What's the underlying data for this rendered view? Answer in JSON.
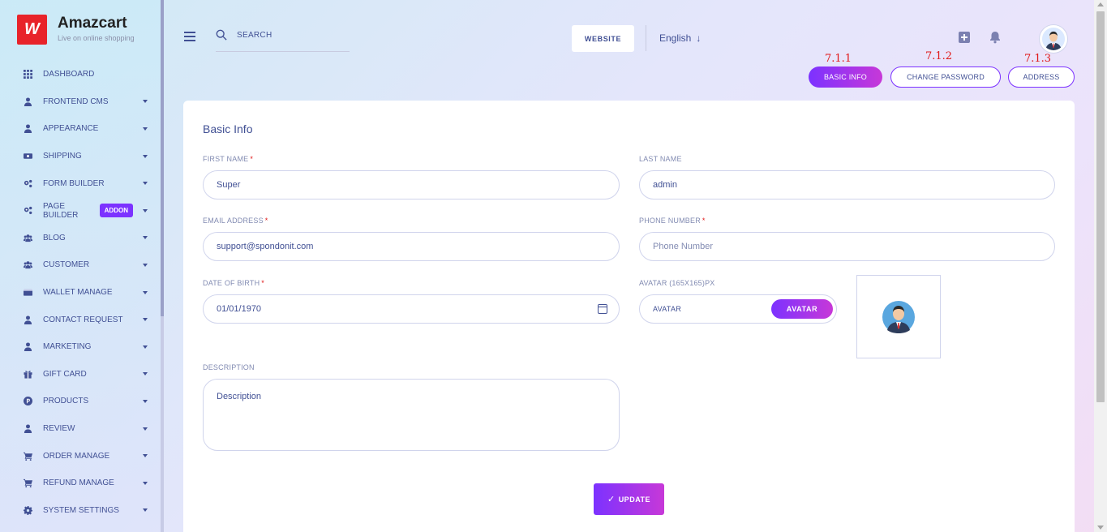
{
  "brand": {
    "title": "Amazcart",
    "subtitle": "Live on online shopping",
    "logo_glyph": "W",
    "color": "#e8232a"
  },
  "sidebar": {
    "items": [
      {
        "label": "DASHBOARD",
        "icon": "grid-icon",
        "has_caret": false
      },
      {
        "label": "FRONTEND CMS",
        "icon": "user-icon",
        "has_caret": true
      },
      {
        "label": "APPEARANCE",
        "icon": "user-icon",
        "has_caret": true
      },
      {
        "label": "SHIPPING",
        "icon": "truck-icon",
        "has_caret": true
      },
      {
        "label": "FORM BUILDER",
        "icon": "gears-icon",
        "has_caret": true
      },
      {
        "label": "PAGE BUILDER",
        "icon": "gears-icon",
        "has_caret": true,
        "badge": "ADDON"
      },
      {
        "label": "BLOG",
        "icon": "users-icon",
        "has_caret": true
      },
      {
        "label": "CUSTOMER",
        "icon": "users-icon",
        "has_caret": true
      },
      {
        "label": "WALLET MANAGE",
        "icon": "wallet-icon",
        "has_caret": true
      },
      {
        "label": "CONTACT REQUEST",
        "icon": "user-icon",
        "has_caret": true
      },
      {
        "label": "MARKETING",
        "icon": "user-icon",
        "has_caret": true
      },
      {
        "label": "GIFT CARD",
        "icon": "gift-icon",
        "has_caret": true
      },
      {
        "label": "PRODUCTS",
        "icon": "product-hunt-icon",
        "has_caret": true
      },
      {
        "label": "REVIEW",
        "icon": "user-icon",
        "has_caret": true
      },
      {
        "label": "ORDER MANAGE",
        "icon": "cart-icon",
        "has_caret": true
      },
      {
        "label": "REFUND MANAGE",
        "icon": "cart-icon",
        "has_caret": true
      },
      {
        "label": "SYSTEM SETTINGS",
        "icon": "gear-icon",
        "has_caret": true
      }
    ]
  },
  "header": {
    "search_placeholder": "SEARCH",
    "website_label": "WEBSITE",
    "language": "English",
    "language_arrow": "↓"
  },
  "tabs": [
    {
      "number": "7.1.1",
      "label": "BASIC INFO",
      "active": true
    },
    {
      "number": "7.1.2",
      "label": "CHANGE PASSWORD",
      "active": false
    },
    {
      "number": "7.1.3",
      "label": "ADDRESS",
      "active": false
    }
  ],
  "form": {
    "title": "Basic Info",
    "required_mark": "*",
    "first_name": {
      "label": "FIRST NAME",
      "value": "Super"
    },
    "last_name": {
      "label": "LAST NAME",
      "value": "admin"
    },
    "email": {
      "label": "EMAIL ADDRESS",
      "value": "support@spondonit.com"
    },
    "phone": {
      "label": "PHONE NUMBER",
      "placeholder": "Phone Number"
    },
    "dob": {
      "label": "DATE OF BIRTH",
      "value": "01/01/1970"
    },
    "avatar": {
      "label": "AVATAR (165X165)PX",
      "placeholder": "AVATAR",
      "button": "AVATAR"
    },
    "description": {
      "label": "DESCRIPTION",
      "placeholder": "Description"
    },
    "update_label": "UPDATE",
    "update_check": "✓"
  },
  "colors": {
    "accent": "#7c32ff",
    "accent2": "#c738d8",
    "text": "#415094",
    "marker": "#e01818"
  }
}
